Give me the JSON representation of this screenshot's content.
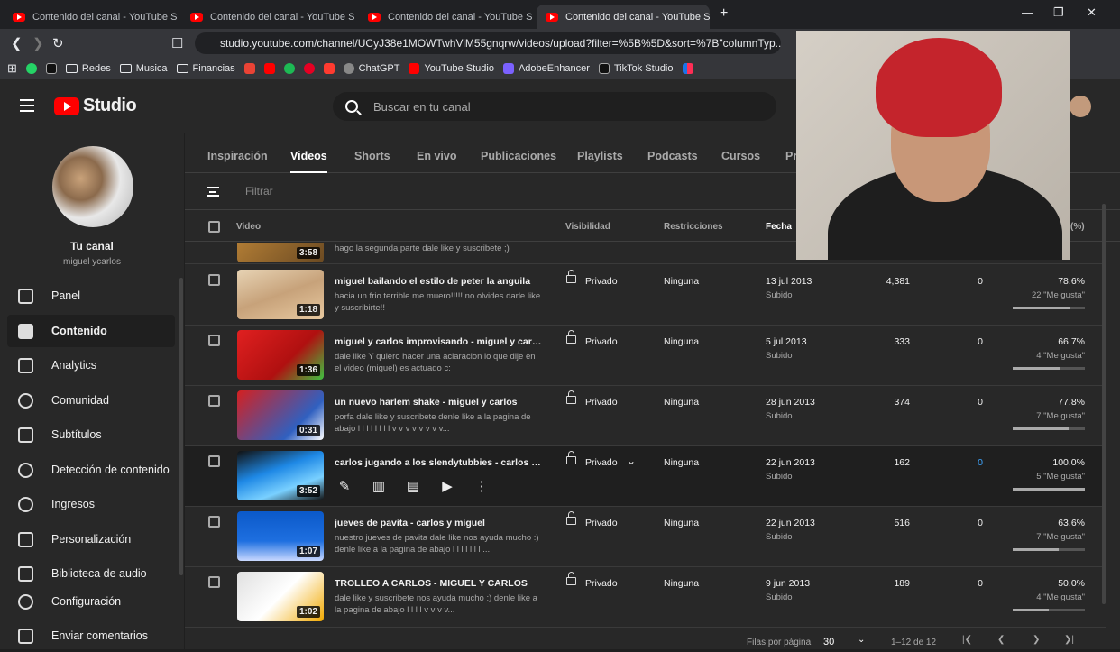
{
  "browser": {
    "tabs": [
      {
        "label": "Contenido del canal - YouTube Studio"
      },
      {
        "label": "Contenido del canal - YouTube Studio"
      },
      {
        "label": "Contenido del canal - YouTube Studio"
      },
      {
        "label": "Contenido del canal - YouTube S"
      }
    ],
    "url": "studio.youtube.com/channel/UCyJ38e1MOWTwhViM55gnqrw/videos/upload?filter=%5B%5D&sort=%7B\"columnTyp...",
    "bookmarks": [
      "Redes",
      "Musica",
      "Financias",
      "ChatGPT",
      "YouTube Studio",
      "AdobeEnhancer",
      "TikTok Studio"
    ]
  },
  "header": {
    "logo_text": "Studio",
    "search_placeholder": "Buscar en tu canal"
  },
  "sidebar": {
    "channel_title": "Tu canal",
    "channel_name": "miguel ycarlos",
    "items": [
      {
        "label": "Panel",
        "icon": "dashboard-icon"
      },
      {
        "label": "Contenido",
        "icon": "content-icon"
      },
      {
        "label": "Analytics",
        "icon": "analytics-icon"
      },
      {
        "label": "Comunidad",
        "icon": "community-icon"
      },
      {
        "label": "Subtítulos",
        "icon": "subtitles-icon"
      },
      {
        "label": "Detección de contenido",
        "icon": "copyright-icon"
      },
      {
        "label": "Ingresos",
        "icon": "dollar-icon"
      },
      {
        "label": "Personalización",
        "icon": "wand-icon"
      },
      {
        "label": "Biblioteca de audio",
        "icon": "audio-library-icon"
      }
    ],
    "bottom": [
      {
        "label": "Configuración",
        "icon": "gear-icon"
      },
      {
        "label": "Enviar comentarios",
        "icon": "feedback-icon"
      }
    ]
  },
  "content_tabs": [
    "Inspiración",
    "Videos",
    "Shorts",
    "En vivo",
    "Publicaciones",
    "Playlists",
    "Podcasts",
    "Cursos",
    "Pr"
  ],
  "filter_placeholder": "Filtrar",
  "table": {
    "headers": {
      "video": "Video",
      "visibility": "Visibilidad",
      "restrictions": "Restricciones",
      "date": "Fecha",
      "pct": "(%)"
    },
    "partial_row": {
      "duration": "3:58",
      "desc": "hago la segunda parte dale like y suscribete ;)"
    },
    "rows": [
      {
        "title": "miguel bailando el estilo de peter la anguila",
        "desc": "hacia un frio terrible me muero!!!!! no olvides darle like y suscribirte!!",
        "duration": "1:18",
        "visibility": "Privado",
        "restrictions": "Ninguna",
        "date": "13 jul 2013",
        "date_sub": "Subido",
        "views": "4,381",
        "comments": "0",
        "pct": "78.6%",
        "likes": "22 \"Me gusta\"",
        "ratio": 0.786
      },
      {
        "title": "miguel y carlos improvisando - miguel y carlos",
        "desc": "dale like Y quiero hacer una aclaracion lo que dije en el video (miguel) es actuado c:",
        "duration": "1:36",
        "visibility": "Privado",
        "restrictions": "Ninguna",
        "date": "5 jul 2013",
        "date_sub": "Subido",
        "views": "333",
        "comments": "0",
        "pct": "66.7%",
        "likes": "4 \"Me gusta\"",
        "ratio": 0.667
      },
      {
        "title": "un nuevo harlem shake - miguel y carlos",
        "desc": "porfa dale like y suscribete denle like a la pagina de abajo l l l l l l l l v v v v v v v v...",
        "duration": "0:31",
        "visibility": "Privado",
        "restrictions": "Ninguna",
        "date": "28 jun 2013",
        "date_sub": "Subido",
        "views": "374",
        "comments": "0",
        "pct": "77.8%",
        "likes": "7 \"Me gusta\"",
        "ratio": 0.778
      },
      {
        "title": "carlos jugando a los slendytubbies - carlos y m...",
        "desc": "",
        "duration": "3:52",
        "visibility": "Privado",
        "restrictions": "Ninguna",
        "date": "22 jun 2013",
        "date_sub": "Subido",
        "views": "162",
        "comments": "0",
        "pct": "100.0%",
        "likes": "5 \"Me gusta\"",
        "ratio": 1.0
      },
      {
        "title": "jueves de pavita - carlos y miguel",
        "desc": "nuestro jueves de pavita dale like nos ayuda mucho :) denle like a la pagina de abajo l l l l l l l ...",
        "duration": "1:07",
        "visibility": "Privado",
        "restrictions": "Ninguna",
        "date": "22 jun 2013",
        "date_sub": "Subido",
        "views": "516",
        "comments": "0",
        "pct": "63.6%",
        "likes": "7 \"Me gusta\"",
        "ratio": 0.636
      },
      {
        "title": "TROLLEO A CARLOS - MIGUEL Y CARLOS",
        "desc": "dale like y suscribete nos ayuda mucho :) denle like a la pagina de abajo l l l l v v v v...",
        "duration": "1:02",
        "visibility": "Privado",
        "restrictions": "Ninguna",
        "date": "9 jun 2013",
        "date_sub": "Subido",
        "views": "189",
        "comments": "0",
        "pct": "50.0%",
        "likes": "4 \"Me gusta\"",
        "ratio": 0.5
      }
    ]
  },
  "footer": {
    "rows_label": "Filas por página:",
    "rows_value": "30",
    "range": "1–12 de 12"
  }
}
